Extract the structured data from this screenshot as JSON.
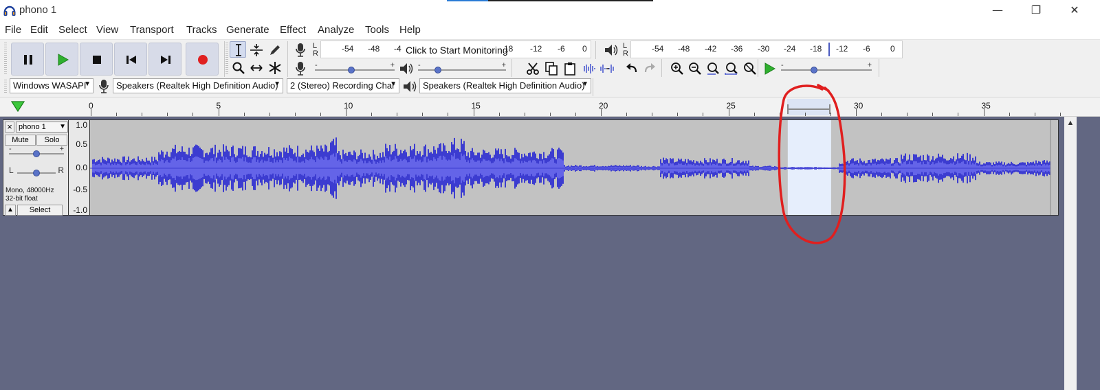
{
  "window": {
    "title": "phono 1",
    "minimize_glyph": "—",
    "restore_glyph": "❐",
    "close_glyph": "✕"
  },
  "menu": [
    "File",
    "Edit",
    "Select",
    "View",
    "Transport",
    "Tracks",
    "Generate",
    "Effect",
    "Analyze",
    "Tools",
    "Help"
  ],
  "record_meter": {
    "ticks": [
      "-54",
      "-48",
      "-4",
      "18",
      "-12",
      "-6",
      "0"
    ],
    "monitor_text": "Click to Start Monitoring",
    "l": "L",
    "r": "R"
  },
  "playback_meter": {
    "ticks": [
      "-54",
      "-48",
      "-42",
      "-36",
      "-30",
      "-24",
      "-18",
      "-12",
      "-6",
      "0"
    ],
    "l": "L",
    "r": "R"
  },
  "sliders": {
    "minus": "-",
    "plus": "+",
    "record_volume": 0.45,
    "playback_volume": 0.2,
    "play_speed": 0.35
  },
  "devices": {
    "host": "Windows WASAPI",
    "recording_device": "Speakers (Realtek High Definition Audio)",
    "channels": "2 (Stereo) Recording Char",
    "playback_device": "Speakers (Realtek High Definition Audio)"
  },
  "timeline": {
    "labels": [
      "0",
      "5",
      "10",
      "15",
      "20",
      "25",
      "30",
      "35"
    ],
    "selection_start": 27.3,
    "selection_end": 29.0
  },
  "track": {
    "close": "×",
    "name": "phono 1",
    "mute": "Mute",
    "solo": "Solo",
    "gain_minus": "-",
    "gain_plus": "+",
    "pan_left": "L",
    "pan_right": "R",
    "format_line1": "Mono, 48000Hz",
    "format_line2": "32-bit float",
    "collapse": "▲",
    "select": "Select",
    "vruler": [
      "1.0",
      "0.5",
      "0.0",
      "-0.5",
      "-1.0"
    ]
  },
  "colors": {
    "waveform": "#3c3cd0",
    "waveform_rms": "#6464e8",
    "wave_bg": "#c2c2c2",
    "selection": "#e6eefc",
    "annotation": "#e01f1f",
    "track_bg": "#626782",
    "record": "#e02020",
    "play": "#2fb02f"
  }
}
